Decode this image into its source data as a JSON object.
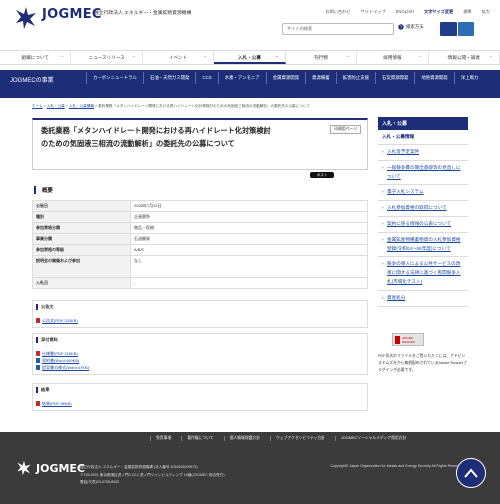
{
  "header": {
    "brand": "JOGMEC",
    "brand_sub": "独立行政法人 エネルギー・金属鉱物資源機構",
    "util_links": [
      "お問い合わせ",
      "サイトマップ",
      "ENGLISH",
      "文字サイズ変更",
      "標準",
      "拡大"
    ],
    "search_placeholder": "サイト内検索",
    "search_button": "検索方法"
  },
  "gnav": [
    "組織について",
    "ニュースリリース",
    "イベント",
    "入札・公募",
    "刊行物",
    "採用情報",
    "情報公開・調達"
  ],
  "subnav": {
    "section": "JOGMECの事業",
    "items": [
      "カーボンニュートラル",
      "石油・天然ガス開発",
      "CCS",
      "水素・アンモニア",
      "金属資源開発",
      "資源備蓄",
      "鉱害防止支援",
      "石炭資源開発",
      "地熱資源開発",
      "洋上風力"
    ]
  },
  "breadcrumb": {
    "home": "ホーム",
    "l1": "入札・公募",
    "l2": "入札・公募情報",
    "current": "委託業務「メタンハイドレート開発における再ハイドレート化対策検討のための気固液三相流の流動解析」の委託先の公募について"
  },
  "main": {
    "title": "委託業務「メタンハイドレート開発における再ハイドレート化対策検討のための気固液三相流の流動解析」の委託先の公募について",
    "print_label": "印刷用ページ",
    "tweet_label": "ポスト",
    "overview_heading": "概要",
    "overview": [
      {
        "key": "公告日",
        "value": "2026年7月22日"
      },
      {
        "key": "種別",
        "value": "企画競争"
      },
      {
        "key": "参加資格分類",
        "value": "物品・役務"
      },
      {
        "key": "事業分類",
        "value": "石油開発"
      },
      {
        "key": "参加資格の等級",
        "value": "A/B/C"
      },
      {
        "key": "説明会の開催および参加",
        "value": "なし"
      },
      {
        "key": "入札日",
        "value": "-"
      }
    ]
  },
  "attachments": {
    "notice_heading": "公告文",
    "notice_files": [
      "公告文(PDF:233KB)"
    ],
    "attach_heading": "添付資料",
    "attach_files": [
      {
        "label": "仕様書(PDF:218KB)",
        "type": "pdf"
      },
      {
        "label": "契約書(Word:469KB)",
        "type": "word"
      },
      {
        "label": "提案書の様式(Word:47KB)",
        "type": "word"
      }
    ],
    "result_heading": "結果",
    "result_files": [
      "結果(PDF:96KB)"
    ]
  },
  "sidebar": {
    "heading": "入札・公募",
    "sub": "入札・公募情報",
    "items": [
      "入札等予定案件",
      "一般競争費の算出基礎等の見直しについて",
      "電子入札システム",
      "入札参加資格の取得について",
      "契約に係る情報の公表について",
      "金属鉱産物備蓄物資の入札参加資格登録(令和04～06年度)について",
      "競争の導入による公共サービスの改革に関する法律に基づく民間競争入札(市場化テスト)",
      "資産処分"
    ],
    "adobe_label": "ADOBE READER",
    "adobe_note": "PDF形式のファイルをご覧いただくには、アドビシステムズ社から無償配布されているAdobe Readerプラグインが必要です。"
  },
  "footer": {
    "links": [
      "免責事項",
      "著作権について",
      "個人情報保護方針",
      "ウェブアクセシビリティ方針",
      "JOGMECソーシャルメディア運用方針"
    ],
    "brand": "JOGMEC",
    "address_lines": [
      "独立行政法人 エネルギー・金属鉱物資源機構 (法人番号 4010405009573)",
      "〒105-0001 東京都港区虎ノ門2-10-1 虎ノ門ツインビルディング 16階(JOGMEC 総合受付)",
      "電話(代表)03-6758-8000"
    ],
    "copyright": "Copyright© Japan Organization for Metals and Energy Security All Rights Reserved."
  },
  "colors": {
    "navy": "#1d2d78",
    "link": "#1d4aa3",
    "footer": "#3b3b3b"
  }
}
